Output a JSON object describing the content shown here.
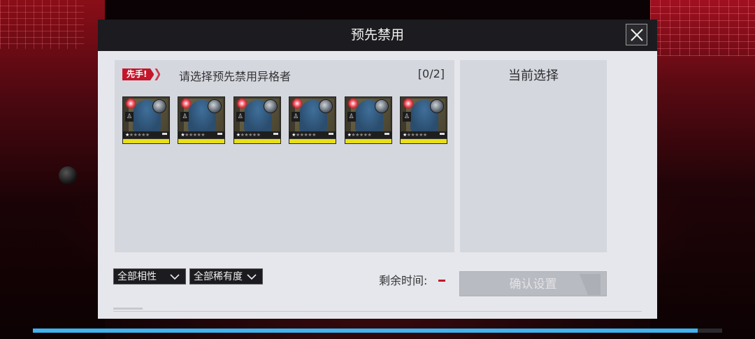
{
  "dialog": {
    "title": "预先禁用",
    "close_icon": "close-icon"
  },
  "selection": {
    "first_badge": "先手!",
    "instruction": "请选择预先禁用异格者",
    "counter": "[0/2]"
  },
  "current": {
    "title": "当前选择"
  },
  "cards": [
    {
      "stars": 1,
      "max_stars": 6
    },
    {
      "stars": 1,
      "max_stars": 6
    },
    {
      "stars": 1,
      "max_stars": 6
    },
    {
      "stars": 1,
      "max_stars": 6
    },
    {
      "stars": 1,
      "max_stars": 6
    },
    {
      "stars": 1,
      "max_stars": 6
    }
  ],
  "filters": {
    "element": "全部相性",
    "rarity": "全部稀有度"
  },
  "timer": {
    "label": "剩余时间:"
  },
  "confirm_label": "确认设置",
  "loading": {
    "progress": 0.965
  },
  "colors": {
    "accent_red": "#c4162a",
    "rarity_yellow": "#e8df1a",
    "progress_blue": "#3fb4ef"
  }
}
